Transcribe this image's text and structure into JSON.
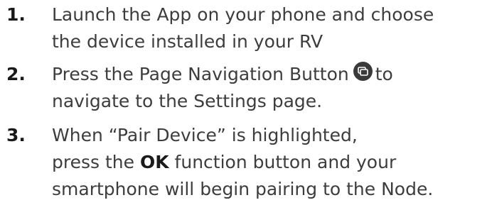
{
  "steps": [
    {
      "number": "1.",
      "lines": [
        "Launch the App on your phone and choose",
        "the device installed in your RV"
      ]
    },
    {
      "number": "2.",
      "line1_before_icon": "Press the Page Navigation Button",
      "line1_after_icon": "to",
      "line2": "navigate to the Settings page.",
      "icon": "page-navigation-icon"
    },
    {
      "number": "3.",
      "line1": "When “Pair Device” is highlighted,",
      "line2_before": "press the",
      "line2_bold": "OK",
      "line2_after": "function button and your",
      "line3": "smartphone will begin pairing to the Node."
    }
  ]
}
